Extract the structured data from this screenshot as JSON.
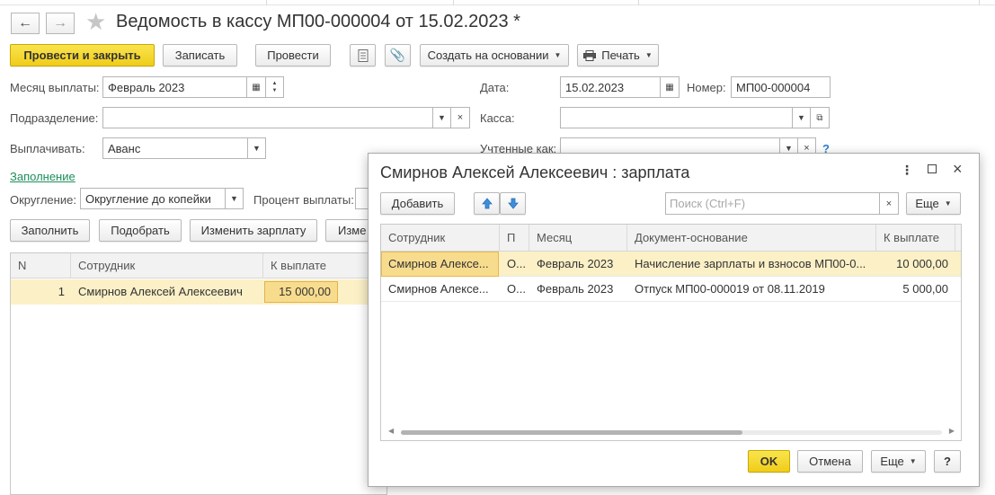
{
  "window": {
    "title": "Ведомость в кассу МП00-000004 от 15.02.2023 *",
    "nav_back_icon": "arrow-left-icon",
    "nav_forward_icon": "arrow-right-icon",
    "favorite_icon": "star-icon"
  },
  "toolbar": {
    "post_close": "Провести и закрыть",
    "save": "Записать",
    "post": "Провести",
    "create_based": "Создать на основании",
    "print": "Печать"
  },
  "form": {
    "month_label": "Месяц выплаты:",
    "month_value": "Февраль 2023",
    "date_label": "Дата:",
    "date_value": "15.02.2023",
    "number_label": "Номер:",
    "number_value": "МП00-000004",
    "division_label": "Подразделение:",
    "division_value": "",
    "cash_label": "Касса:",
    "cash_value": "",
    "pay_label": "Выплачивать:",
    "pay_value": "Аванс",
    "accounted_label": "Учтенные как:",
    "fill_link": "Заполнение",
    "rounding_label": "Округление:",
    "rounding_value": "Округление до копейки",
    "percent_label": "Процент выплаты:"
  },
  "actions": {
    "fill": "Заполнить",
    "select": "Подобрать",
    "change_salary": "Изменить зарплату",
    "change_more": "Изме"
  },
  "main_table": {
    "headers": [
      "N",
      "Сотрудник",
      "К выплате"
    ],
    "rows": [
      {
        "n": "1",
        "employee": "Смирнов Алексей Алексеевич",
        "amount": "15 000,00"
      }
    ]
  },
  "dialog": {
    "title": "Смирнов Алексей Алексеевич : зарплата",
    "add": "Добавить",
    "search_placeholder": "Поиск (Ctrl+F)",
    "more": "Еще",
    "headers": [
      "Сотрудник",
      "П",
      "Месяц",
      "Документ-основание",
      "К выплате"
    ],
    "rows": [
      {
        "employee": "Смирнов Алексе...",
        "p": "О...",
        "month": "Февраль 2023",
        "doc": "Начисление зарплаты и взносов МП00-0...",
        "amount": "10 000,00"
      },
      {
        "employee": "Смирнов Алексе...",
        "p": "О...",
        "month": "Февраль 2023",
        "doc": "Отпуск МП00-000019 от 08.11.2019",
        "amount": "5 000,00"
      }
    ],
    "ok": "OK",
    "cancel": "Отмена",
    "more_bottom": "Еще",
    "help": "?"
  },
  "colors": {
    "primary_button": "#f3d42a",
    "selected_row": "#fbf0c6",
    "link": "#1d8f5a",
    "arrow_blue": "#3d8fdc"
  }
}
